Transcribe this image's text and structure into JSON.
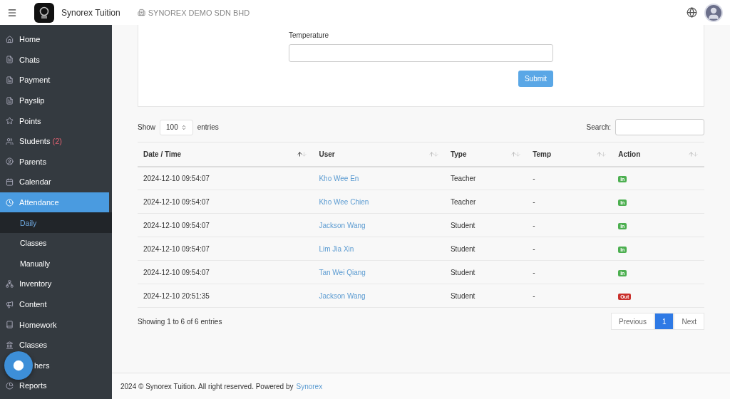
{
  "topbar": {
    "app_name": "Synorex Tuition",
    "company": "SYNOREX DEMO SDN BHD"
  },
  "sidebar": {
    "items": [
      {
        "label": "Home",
        "selected": false
      },
      {
        "label": "Chats",
        "selected": false
      },
      {
        "label": "Payment",
        "selected": false
      },
      {
        "label": "Payslip",
        "selected": false
      },
      {
        "label": "Points",
        "selected": false
      },
      {
        "label": "Students",
        "count": "(2)",
        "selected": false
      },
      {
        "label": "Parents",
        "selected": false
      },
      {
        "label": "Calendar",
        "selected": false
      },
      {
        "label": "Attendance",
        "selected": true,
        "expanded": true,
        "children": [
          {
            "label": "Daily",
            "selected": true
          },
          {
            "label": "Classes",
            "selected": false
          },
          {
            "label": "Manually",
            "selected": false
          }
        ]
      },
      {
        "label": "Inventory",
        "selected": false
      },
      {
        "label": "Content",
        "selected": false
      },
      {
        "label": "Homework",
        "selected": false
      },
      {
        "label": "Classes",
        "selected": false
      },
      {
        "label": "hers",
        "kind": "covered",
        "selected": false
      },
      {
        "label": "Reports",
        "selected": false
      }
    ]
  },
  "form": {
    "label": "Temperature",
    "submit": "Submit"
  },
  "table_controls": {
    "show": "Show",
    "page_size": "100",
    "entries": "entries",
    "search_label": "Search:"
  },
  "table": {
    "columns": [
      {
        "label": "Date / Time",
        "sorted": true
      },
      {
        "label": "User",
        "sorted": false
      },
      {
        "label": "Type",
        "sorted": false
      },
      {
        "label": "Temp",
        "sorted": false
      },
      {
        "label": "Action",
        "sorted": false
      }
    ],
    "rows": [
      {
        "datetime": "2024-12-10 09:54:07",
        "user": "Kho Wee En",
        "type": "Teacher",
        "temp": "-",
        "action": "In",
        "kind": "in"
      },
      {
        "datetime": "2024-12-10 09:54:07",
        "user": "Kho Wee Chien",
        "type": "Teacher",
        "temp": "-",
        "action": "In",
        "kind": "in"
      },
      {
        "datetime": "2024-12-10 09:54:07",
        "user": "Jackson Wang",
        "type": "Student",
        "temp": "-",
        "action": "In",
        "kind": "in"
      },
      {
        "datetime": "2024-12-10 09:54:07",
        "user": "Lim Jia Xin",
        "type": "Student",
        "temp": "-",
        "action": "In",
        "kind": "in"
      },
      {
        "datetime": "2024-12-10 09:54:07",
        "user": "Tan Wei Qiang",
        "type": "Student",
        "temp": "-",
        "action": "In",
        "kind": "in"
      },
      {
        "datetime": "2024-12-10 20:51:35",
        "user": "Jackson Wang",
        "type": "Student",
        "temp": "-",
        "action": "Out",
        "kind": "out"
      }
    ]
  },
  "table_info": "Showing 1 to 6 of 6 entries",
  "pagination": [
    {
      "label": "Previous",
      "selected": false
    },
    {
      "label": "1",
      "selected": true
    },
    {
      "label": "Next",
      "selected": false
    }
  ],
  "footer": {
    "text": "2024 © Synorex Tuition. All right reserved. Powered by",
    "link": "Synorex"
  }
}
